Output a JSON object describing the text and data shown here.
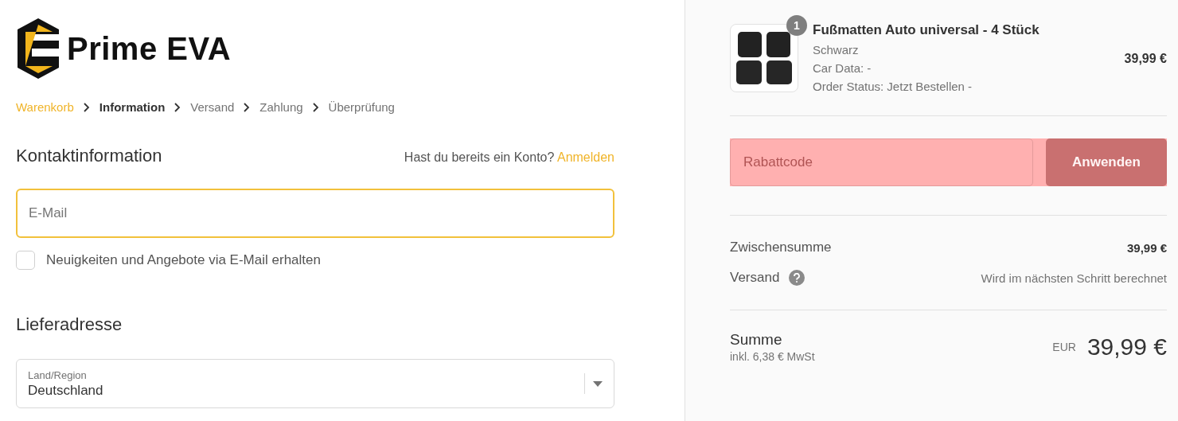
{
  "logo": {
    "text": "Prime EVA"
  },
  "breadcrumb": [
    {
      "label": "Warenkorb",
      "kind": "link"
    },
    {
      "label": "Information",
      "kind": "current"
    },
    {
      "label": "Versand",
      "kind": "step"
    },
    {
      "label": "Zahlung",
      "kind": "step"
    },
    {
      "label": "Überprüfung",
      "kind": "step"
    }
  ],
  "contact": {
    "title": "Kontaktinformation",
    "account_prompt": "Hast du bereits ein Konto?",
    "login_link": "Anmelden",
    "email": {
      "placeholder": "E-Mail",
      "focused": true
    },
    "newsletter": {
      "label": "Neuigkeiten und Angebote via E-Mail erhalten",
      "checked": false
    }
  },
  "shipping": {
    "title": "Lieferadresse",
    "country": {
      "label": "Land/Region",
      "value": "Deutschland"
    }
  },
  "cart": {
    "items": [
      {
        "quantity": "1",
        "name": "Fußmatten Auto universal - 4 Stück",
        "variant": "Schwarz",
        "details": [
          "Car Data: -",
          "Order Status: Jetzt Bestellen -"
        ],
        "price": "39,99 €"
      }
    ],
    "discount": {
      "placeholder": "Rabattcode",
      "button": "Anwenden",
      "highlighted": true
    },
    "subtotal": {
      "label": "Zwischensumme",
      "value": "39,99 €"
    },
    "shipping": {
      "label": "Versand",
      "value": "Wird im nächsten Schritt berechnet"
    },
    "total": {
      "label": "Summe",
      "tax": "inkl. 6,38 € MwSt",
      "currency": "EUR",
      "value": "39,99 €"
    }
  }
}
